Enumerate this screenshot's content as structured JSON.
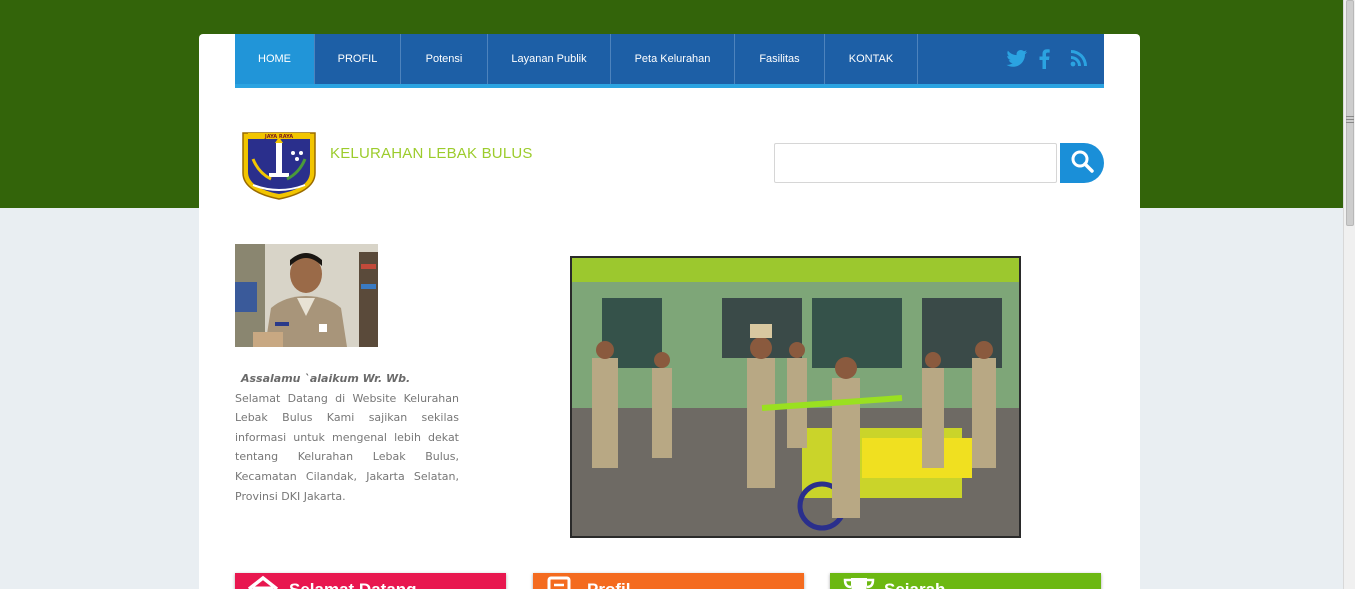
{
  "nav": {
    "items": [
      {
        "label": "HOME",
        "active": true
      },
      {
        "label": "PROFIL"
      },
      {
        "label": "Potensi"
      },
      {
        "label": "Layanan Publik"
      },
      {
        "label": "Peta Kelurahan"
      },
      {
        "label": "Fasilitas"
      },
      {
        "label": "KONTAK"
      }
    ],
    "social": [
      "twitter-icon",
      "facebook-icon",
      "rss-icon"
    ]
  },
  "header": {
    "logo_text": "JAYA RAYA",
    "title": "KELURAHAN LEBAK BULUS"
  },
  "search": {
    "placeholder": "",
    "icon": "search-icon"
  },
  "welcome": {
    "greeting": "Assalamu `alaikum Wr. Wb.",
    "body": "Selamat Datang di Website Kelurahan Lebak Bulus Kami sajikan sekilas informasi untuk mengenal lebih dekat tentang Kelurahan Lebak Bulus, Kecamatan Cilandak, Jakarta Selatan, Provinsi DKI Jakarta."
  },
  "cards": [
    {
      "label": "Selamat Datang",
      "color": "#e8174f",
      "icon": "home-icon"
    },
    {
      "label": "Profil",
      "color": "#f46b1f",
      "icon": "document-icon"
    },
    {
      "label": "Sejarah",
      "color": "#6cb812",
      "icon": "trophy-icon"
    }
  ],
  "colors": {
    "top_band": "#33640a",
    "nav": "#1d5fa6",
    "nav_active": "#2195d8",
    "accent": "#2ba3e1",
    "title": "#9ccc2c"
  }
}
